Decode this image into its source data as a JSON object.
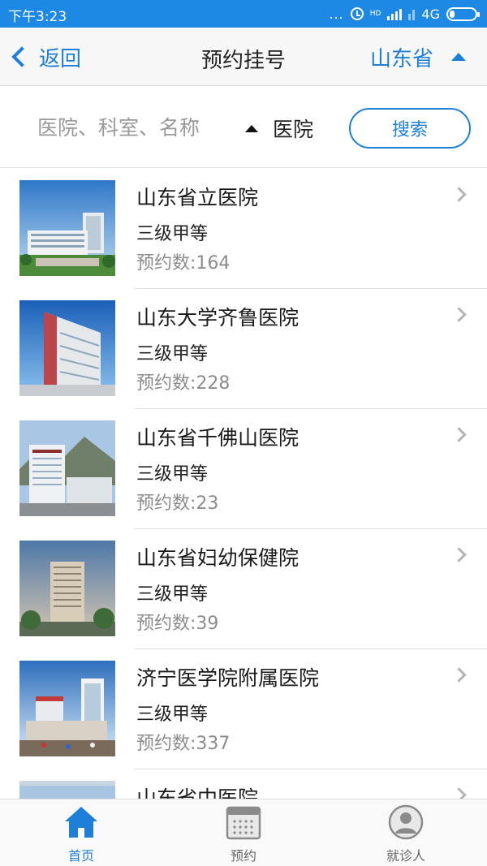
{
  "status_bar": {
    "time": "下午3:23",
    "dots": "...",
    "hd": "HD",
    "network": "4G"
  },
  "nav": {
    "back_label": "返回",
    "title": "预约挂号",
    "province": "山东省"
  },
  "search": {
    "placeholder": "医院、科室、名称",
    "type": "医院",
    "button_label": "搜索"
  },
  "hospitals": [
    {
      "name": "山东省立医院",
      "level": "三级甲等",
      "count_label": "预约数:164"
    },
    {
      "name": "山东大学齐鲁医院",
      "level": "三级甲等",
      "count_label": "预约数:228"
    },
    {
      "name": "山东省千佛山医院",
      "level": "三级甲等",
      "count_label": "预约数:23"
    },
    {
      "name": "山东省妇幼保健院",
      "level": "三级甲等",
      "count_label": "预约数:39"
    },
    {
      "name": "济宁医学院附属医院",
      "level": "三级甲等",
      "count_label": "预约数:337"
    },
    {
      "name": "山东省中医院",
      "level": "",
      "count_label": ""
    }
  ],
  "tabs": [
    {
      "label": "首页",
      "icon": "home-icon",
      "active": true
    },
    {
      "label": "预约",
      "icon": "calendar-icon",
      "active": false
    },
    {
      "label": "就诊人",
      "icon": "person-icon",
      "active": false
    }
  ],
  "colors": {
    "accent": "#1e7fd8",
    "status_bar": "#1e88e5"
  }
}
